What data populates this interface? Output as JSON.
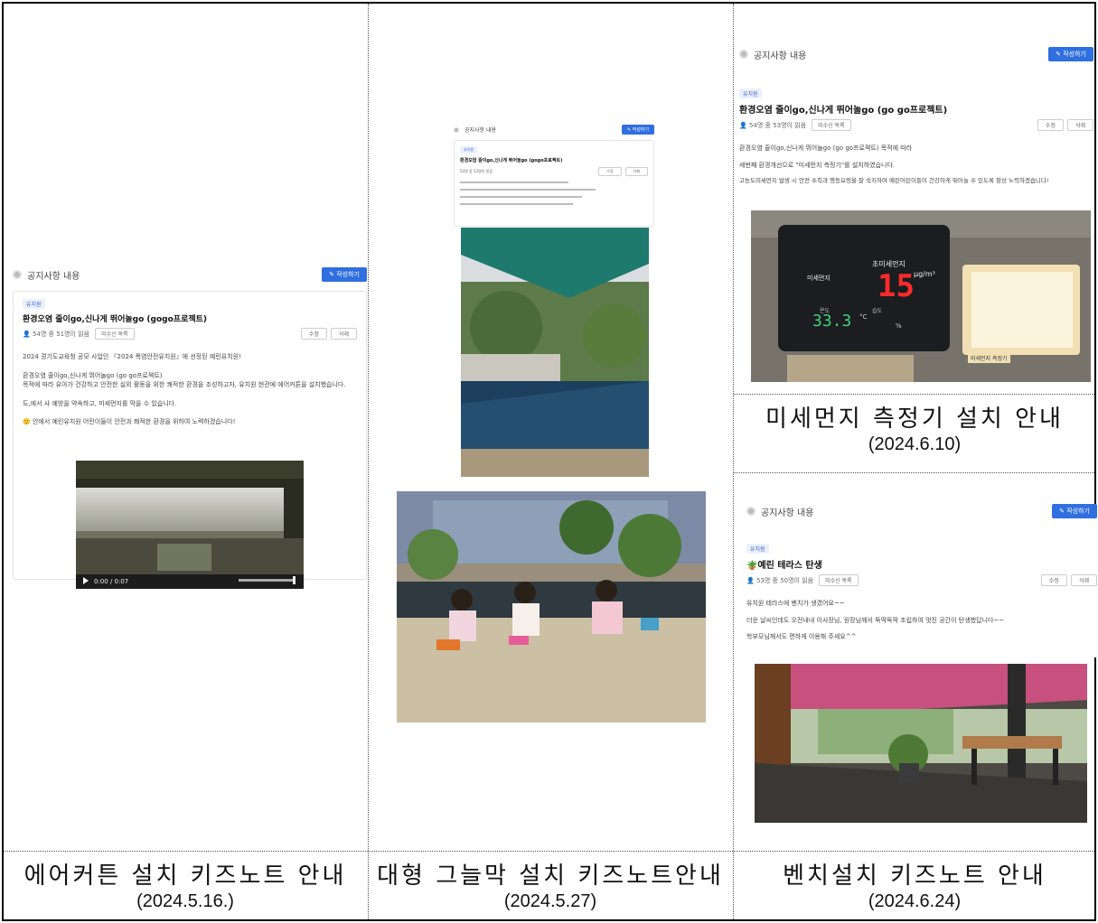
{
  "screen_header": "공지사항 내용",
  "write_button": "작성하기",
  "edit_button": "수정",
  "delete_button": "삭제",
  "reader_list": "미수신 목록",
  "panels": {
    "aircurtain": {
      "caption": "에어커튼 설치 키즈노트 안내",
      "date": "(2024.5.16.)",
      "tag": "유치원",
      "title": "환경오염 줄이go,신나게 뛰어놀go (gogo프로젝트)",
      "meta": "54명 중 51명이 읽음",
      "body": [
        "2024 경기도교육청 공모 사업인 『2024 폭염안전유치원』에 선정된 예린유치원!",
        "환경오염 줄이go,신나게 뛰어놀go (go go프로젝트)",
        "목적에 따라 유아가 건강하고 안전한 실외 활동을 위한 쾌적한 환경을 조성하고자, 유치원 현관에 에어커튼을 설치했습니다.",
        "도,에서 사 예방을 약속하고, 미세먼지를 막을 수 있습니다.",
        "안에서 예린유치원 어린이들이 안전과 쾌적한 환경을 위하여 노력하겠습니다!"
      ],
      "video_time": "0:00 / 0:07"
    },
    "shade": {
      "caption": "대형 그늘막 설치 키즈노트안내",
      "date": "(2024.5.27)",
      "tag": "유치원",
      "title": "환경오염 줄이go,신나게 뛰어놀go (gogo프로젝트)",
      "meta": "54명 중 53명이 읽음"
    },
    "dust": {
      "caption": "미세먼지 측정기 설치 안내",
      "date": "(2024.6.10)",
      "tag": "유치원",
      "title": "환경오염 줄이go,신나게 뛰어놀go (go go프로젝트)",
      "meta": "54명 중 53명이 읽음",
      "body": [
        "환경오염 줄이go,신나게 뛰어놀go (go go프로젝트) 목적에 따라",
        "세번째 환경개선으로 \"미세먼지 측정기\"를 설치하였습니다.",
        "고농도미세먼지 발생 시 안전 수칙과 행동요령을 잘 숙지하여 예린어린이들이 건강하게 뛰어놀 수 있도록 항상 노력하겠습니다!"
      ],
      "device_label_fine": "초미세먼지",
      "device_label_dust": "미세먼지",
      "device_value": "15",
      "device_unit": "μg/m³",
      "device_temp_label": "온도",
      "device_humid_label": "습도",
      "device_temp": "33.3",
      "device_temp_unit": "°C",
      "device_humid_unit": "%",
      "device_brand": "미세먼지 측정기"
    },
    "bench": {
      "caption": "벤치설치 키즈노트 안내",
      "date": "(2024.6.24)",
      "tag": "유치원",
      "title": "예린 테라스 탄생",
      "meta": "53명 중 50명이 읽음",
      "body": [
        "유치원 테라스에 벤치가 생겼어요~~",
        "더운 날씨인데도 오전내내 이사장님, 원장님께서 뚝딱뚝딱 조립하여 멋진 공간이 탄생했답니다~~",
        "학부모님께서도 편하게 이용해 주세요^^"
      ]
    }
  }
}
